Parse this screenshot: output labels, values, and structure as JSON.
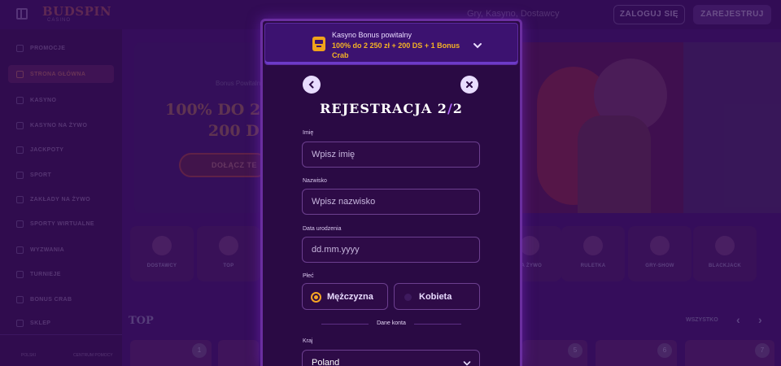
{
  "header": {
    "logo": "BUDSPIN",
    "logo_sub": "CASINO",
    "search_hint": "Gry, Kasyno, Dostawcy",
    "login_label": "ZALOGUJ SIĘ",
    "register_label": "ZAREJESTRUJ"
  },
  "sidebar": {
    "items": [
      {
        "label": "PROMOCJE",
        "icon": "gift-icon"
      },
      {
        "label": "STRONA GŁÓWNA",
        "icon": "home-icon"
      },
      {
        "label": "KASYNO",
        "icon": "slot-icon"
      },
      {
        "label": "KASYNO NA ŻYWO",
        "icon": "live-icon"
      },
      {
        "label": "JACKPOTY",
        "icon": "jackpot-icon"
      },
      {
        "label": "SPORT",
        "icon": "ball-icon"
      },
      {
        "label": "ZAKŁADY NA ŻYWO",
        "icon": "live-bet-icon"
      },
      {
        "label": "SPORTY WIRTUALNE",
        "icon": "virtual-icon"
      },
      {
        "label": "WYZWANIA",
        "icon": "challenge-icon"
      },
      {
        "label": "TURNIEJE",
        "icon": "trophy-icon"
      },
      {
        "label": "BONUS CRAB",
        "icon": "crab-icon"
      },
      {
        "label": "SKLEP",
        "icon": "shop-icon"
      }
    ],
    "bottom_left": "POLSKI",
    "bottom_right": "CENTRUM POMOCY"
  },
  "hero": {
    "small": "Bonus Powitalny",
    "big_line1": "100% DO 2 2",
    "big_line2": "200 D",
    "button": "DOŁĄCZ TE"
  },
  "categories": [
    {
      "label": "DOSTAWCY"
    },
    {
      "label": "TOP"
    },
    {
      "label": "NA ŻYWO"
    },
    {
      "label": "RULETKA"
    },
    {
      "label": "GRY-SHOW"
    },
    {
      "label": "BLACKJACK"
    }
  ],
  "top_section": {
    "title": "TOP",
    "see_all": "WSZYSTKO",
    "thumb_numbers": [
      "1",
      "5",
      "6",
      "7"
    ]
  },
  "modal": {
    "bonus_title": "Kasyno Bonus powitalny",
    "bonus_text": "100% do 2 250 zł + 200 DS + 1 Bonus Crab",
    "title_main": "REJESTRACJA 2",
    "title_slash": "/",
    "title_total": "2",
    "fields": {
      "first_name_label": "Imię",
      "first_name_placeholder": "Wpisz imię",
      "last_name_label": "Nazwisko",
      "last_name_placeholder": "Wpisz nazwisko",
      "dob_label": "Data urodzenia",
      "dob_placeholder": "dd.mm.yyyy",
      "gender_label": "Płeć",
      "gender_male": "Mężczyzna",
      "gender_female": "Kobieta",
      "section_account": "Dane konta",
      "country_label": "Kraj",
      "country_value": "Poland"
    }
  },
  "colors": {
    "accent": "#f5a524",
    "modal_bg": "#2a0a44",
    "border": "#6c3f8f"
  }
}
